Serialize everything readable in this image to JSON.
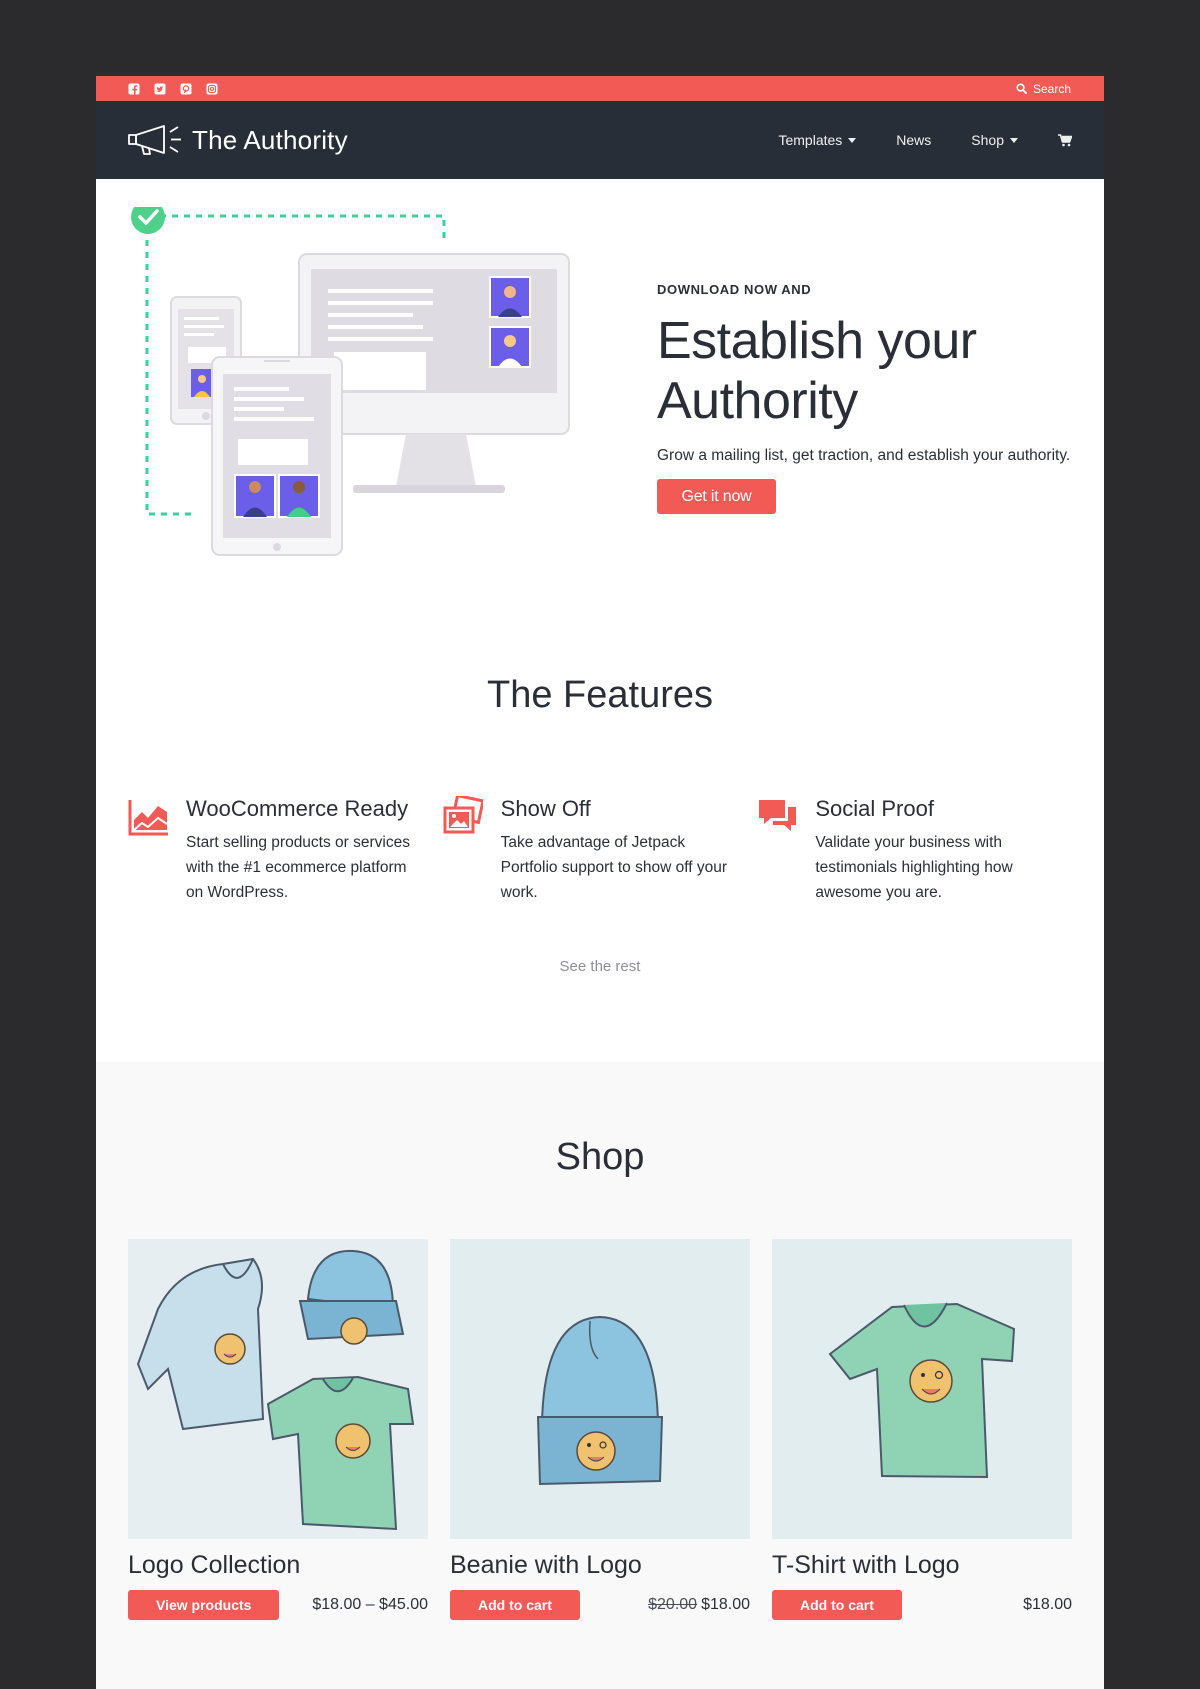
{
  "topbar": {
    "socials": [
      "facebook-icon",
      "twitter-icon",
      "pinterest-icon",
      "instagram-icon"
    ],
    "search_label": "Search"
  },
  "nav": {
    "brand": "The Authority",
    "items": [
      {
        "label": "Templates",
        "has_dropdown": true
      },
      {
        "label": "News",
        "has_dropdown": false
      },
      {
        "label": "Shop",
        "has_dropdown": true
      }
    ],
    "cart_icon": "cart-icon"
  },
  "hero": {
    "eyebrow": "DOWNLOAD NOW AND",
    "title_line1": "Establish your",
    "title_line2": "Authority",
    "subtitle": "Grow a mailing list, get traction, and establish your authority.",
    "cta": "Get it now"
  },
  "features": {
    "title": "The Features",
    "items": [
      {
        "icon": "area-chart-icon",
        "title": "WooCommerce Ready",
        "text": "Start selling products or services with the #1 ecommerce platform on WordPress."
      },
      {
        "icon": "photos-icon",
        "title": "Show Off",
        "text": "Take advantage of Jetpack Portfolio support to show off your work."
      },
      {
        "icon": "comments-icon",
        "title": "Social Proof",
        "text": "Validate your business with testimonials highlighting how awesome you are."
      }
    ],
    "see_rest": "See the rest"
  },
  "shop": {
    "title": "Shop",
    "products": [
      {
        "name": "Logo Collection",
        "button": "View products",
        "price": "$18.00 – $45.00",
        "old_price": ""
      },
      {
        "name": "Beanie with Logo",
        "button": "Add to cart",
        "price": "$18.00",
        "old_price": "$20.00"
      },
      {
        "name": "T-Shirt with Logo",
        "button": "Add to cart",
        "price": "$18.00",
        "old_price": ""
      }
    ]
  },
  "colors": {
    "accent": "#f25a55",
    "nav_bg": "#282e37",
    "page_bg": "#2b2b2d",
    "text": "#2a2f37",
    "shop_bg": "#f9f9f9",
    "check_green": "#4fd18b"
  }
}
